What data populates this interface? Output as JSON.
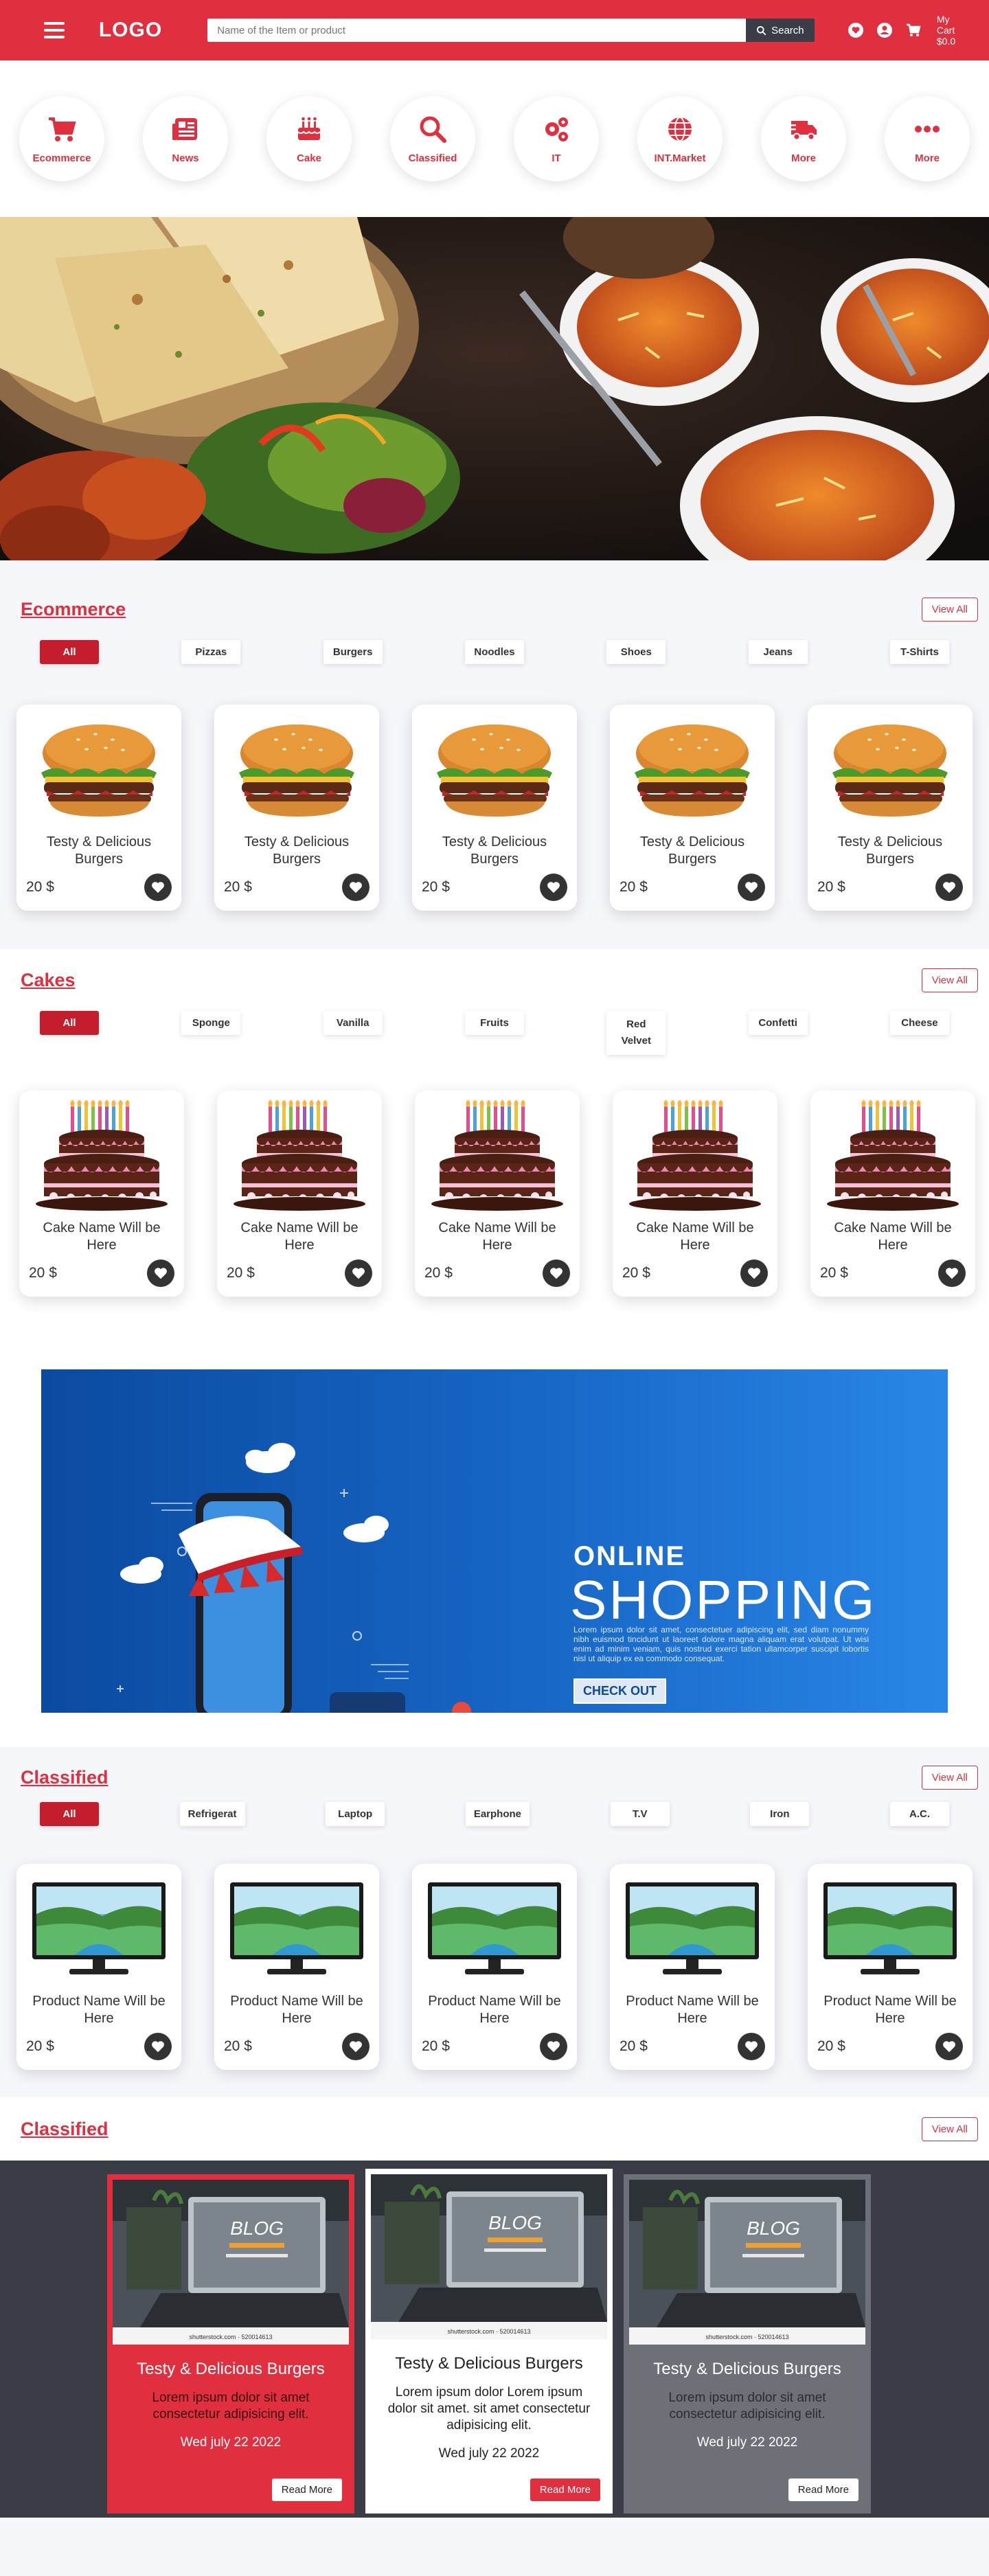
{
  "header": {
    "logo": "LOGO",
    "search_placeholder": "Name of the Item or product",
    "search_button": "Search",
    "cart_label": "My Cart",
    "cart_amount": "$0.0"
  },
  "categories": [
    {
      "label": "Ecommerce",
      "icon": "cart-icon"
    },
    {
      "label": "News",
      "icon": "newspaper-icon"
    },
    {
      "label": "Cake",
      "icon": "cake-icon"
    },
    {
      "label": "Classified",
      "icon": "search-icon"
    },
    {
      "label": "IT",
      "icon": "gears-icon"
    },
    {
      "label": "INT.Market",
      "icon": "globe-icon"
    },
    {
      "label": "More",
      "icon": "truck-icon"
    },
    {
      "label": "More",
      "icon": "dots-icon"
    }
  ],
  "ecommerce": {
    "title": "Ecommerce",
    "view_all": "View All",
    "filters": [
      "All",
      "Pizzas",
      "Burgers",
      "Noodles",
      "Shoes",
      "Jeans",
      "T-Shirts"
    ],
    "products": [
      {
        "name": "Testy & Delicious Burgers",
        "price": "20 $"
      },
      {
        "name": "Testy & Delicious Burgers",
        "price": "20 $"
      },
      {
        "name": "Testy & Delicious Burgers",
        "price": "20 $"
      },
      {
        "name": "Testy & Delicious Burgers",
        "price": "20 $"
      },
      {
        "name": "Testy & Delicious Burgers",
        "price": "20 $"
      }
    ]
  },
  "cakes": {
    "title": "Cakes",
    "view_all": "View All",
    "filters": [
      "All",
      "Sponge",
      "Vanilla",
      "Fruits",
      "Red Velvet",
      "Confetti",
      "Cheese"
    ],
    "products": [
      {
        "name": "Cake Name Will be Here",
        "price": "20 $"
      },
      {
        "name": "Cake Name Will be Here",
        "price": "20 $"
      },
      {
        "name": "Cake Name Will be Here",
        "price": "20 $"
      },
      {
        "name": "Cake Name Will be Here",
        "price": "20 $"
      },
      {
        "name": "Cake Name Will be Here",
        "price": "20 $"
      }
    ]
  },
  "banner": {
    "line1": "ONLINE",
    "line2": "SHOPPING",
    "text": "Lorem ipsum dolor sit amet, consectetuer adipiscing elit, sed diam nonummy nibh euismod tincidunt ut laoreet dolore magna aliquam erat volutpat. Ut wisi enim ad minim veniam, quis nostrud exerci tation ullamcorper suscipit lobortis nisl ut aliquip ex ea commodo consequat.",
    "button": "CHECK OUT"
  },
  "classified": {
    "title": "Classified",
    "view_all": "View All",
    "filters": [
      "All",
      "Refrigerat",
      "Laptop",
      "Earphone",
      "T.V",
      "Iron",
      "A.C."
    ],
    "products": [
      {
        "name": "Product Name Will be Here",
        "price": "20 $"
      },
      {
        "name": "Product Name Will be Here",
        "price": "20 $"
      },
      {
        "name": "Product Name Will be Here",
        "price": "20 $"
      },
      {
        "name": "Product Name Will be Here",
        "price": "20 $"
      },
      {
        "name": "Product Name Will be Here",
        "price": "20 $"
      }
    ]
  },
  "blog_section": {
    "title": "Classified",
    "view_all": "View All",
    "image_text": "BLOG",
    "image_credit": "shutterstock.com · 520014613",
    "posts": [
      {
        "title": "Testy & Delicious Burgers",
        "text": "Lorem ipsum dolor sit amet consectetur adipisicing elit.",
        "date": "Wed july 22 2022",
        "button": "Read More"
      },
      {
        "title": "Testy & Delicious Burgers",
        "text": "Lorem ipsum dolor Lorem ipsum dolor sit amet. sit amet consectetur adipisicing elit.",
        "date": "Wed july 22 2022",
        "button": "Read More"
      },
      {
        "title": "Testy & Delicious Burgers",
        "text": "Lorem ipsum dolor sit amet consectetur adipisicing elit.",
        "date": "Wed july 22 2022",
        "button": "Read More"
      }
    ]
  },
  "colors": {
    "brand": "#e0303f",
    "dark": "#3a3d46",
    "active_pill": "#c41e2e"
  }
}
